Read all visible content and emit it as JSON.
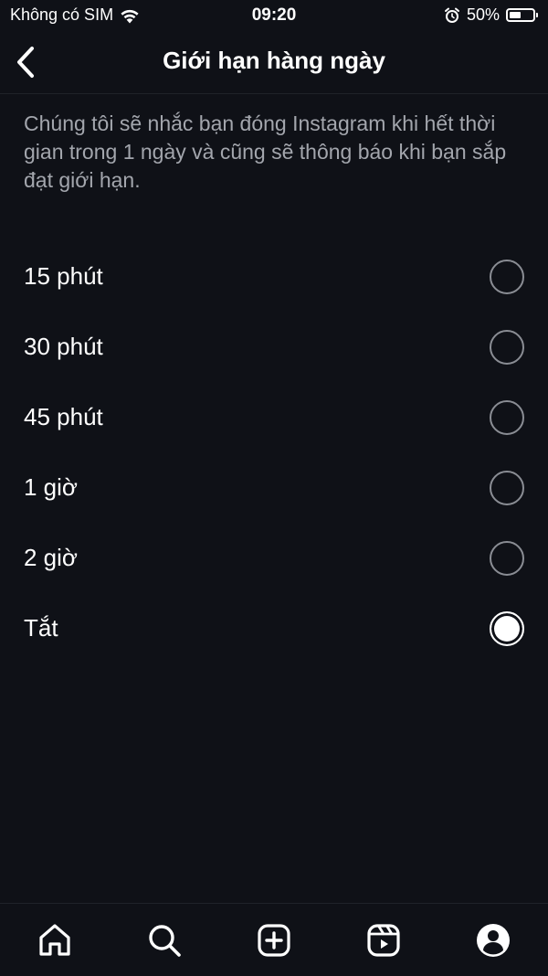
{
  "status_bar": {
    "carrier": "Không có SIM",
    "time": "09:20",
    "battery": "50%",
    "battery_level": 0.5
  },
  "header": {
    "title": "Giới hạn hàng ngày",
    "back_icon": "chevron-left-icon"
  },
  "description": "Chúng tôi sẽ nhắc bạn đóng Instagram khi hết thời gian trong 1 ngày và cũng sẽ thông báo khi bạn sắp đạt giới hạn.",
  "options": [
    {
      "label": "15 phút",
      "selected": false
    },
    {
      "label": "30 phút",
      "selected": false
    },
    {
      "label": "45 phút",
      "selected": false
    },
    {
      "label": "1 giờ",
      "selected": false
    },
    {
      "label": "2 giờ",
      "selected": false
    },
    {
      "label": "Tắt",
      "selected": true
    }
  ],
  "tab_bar": {
    "icons": [
      "home-icon",
      "search-icon",
      "create-icon",
      "reels-icon",
      "profile-icon"
    ]
  },
  "colors": {
    "background": "#0f1117",
    "text": "#ffffff",
    "secondary_text": "#a3a6ad",
    "radio_border": "#8a8d94"
  }
}
